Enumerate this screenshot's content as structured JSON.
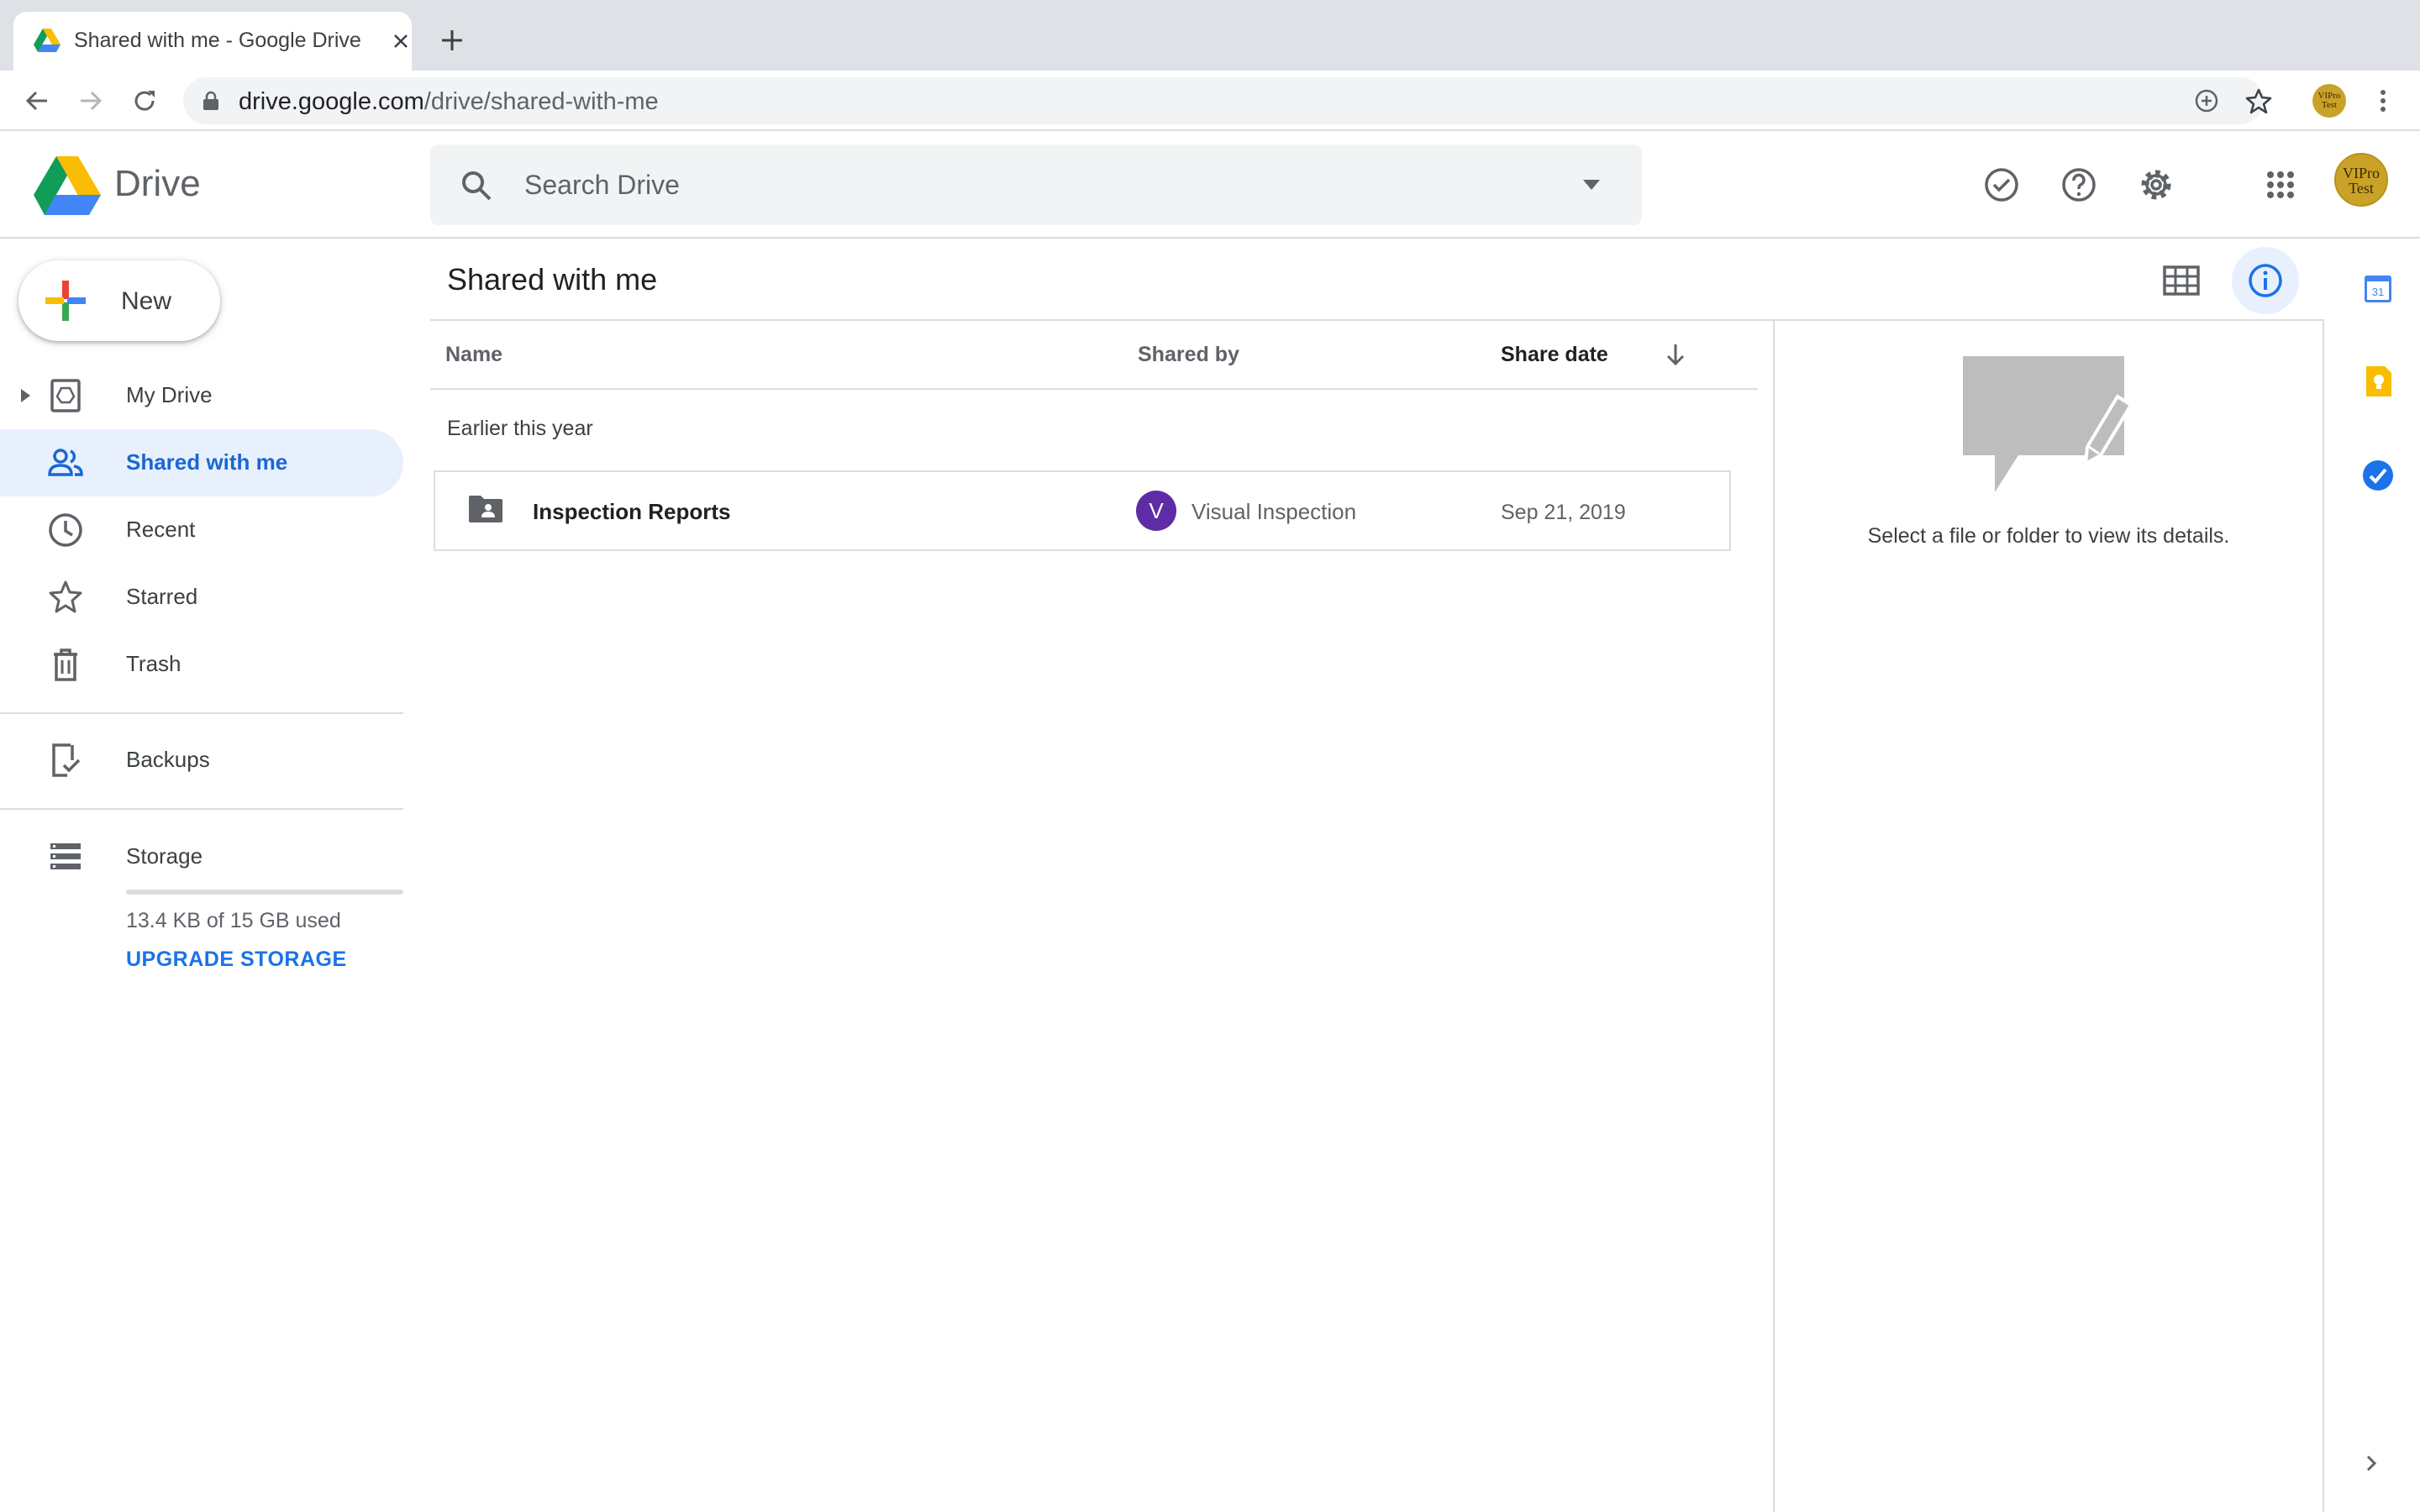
{
  "browser": {
    "tab_title": "Shared with me - Google Drive",
    "url_host": "drive.google.com",
    "url_path": "/drive/shared-with-me",
    "profile_chip": "VIPro Test"
  },
  "header": {
    "app_name": "Drive",
    "search_placeholder": "Search Drive",
    "account_avatar": "VIPro Test"
  },
  "sidebar": {
    "new_label": "New",
    "items": [
      {
        "label": "My Drive",
        "icon": "my-drive-icon"
      },
      {
        "label": "Shared with me",
        "icon": "shared-people-icon",
        "active": true
      },
      {
        "label": "Recent",
        "icon": "clock-icon"
      },
      {
        "label": "Starred",
        "icon": "star-icon"
      },
      {
        "label": "Trash",
        "icon": "trash-icon"
      },
      {
        "label": "Backups",
        "icon": "backups-icon"
      },
      {
        "label": "Storage",
        "icon": "storage-icon"
      }
    ],
    "storage": {
      "used_text": "13.4 KB of 15 GB used",
      "used_fraction": 0.0,
      "upgrade_label": "UPGRADE STORAGE"
    }
  },
  "main": {
    "title": "Shared with me",
    "columns": {
      "name": "Name",
      "shared_by": "Shared by",
      "share_date": "Share date"
    },
    "groups": [
      {
        "label": "Earlier this year",
        "rows": [
          {
            "name": "Inspection Reports",
            "type": "shared-folder",
            "owner_initial": "V",
            "owner_name": "Visual Inspection",
            "share_date": "Sep 21, 2019"
          }
        ]
      }
    ]
  },
  "details": {
    "empty_text": "Select a file or folder to view its details."
  },
  "colors": {
    "accent": "#1a73e8",
    "active_nav_bg": "#e8f0fe",
    "owner_avatar": "#5e2ca5"
  }
}
